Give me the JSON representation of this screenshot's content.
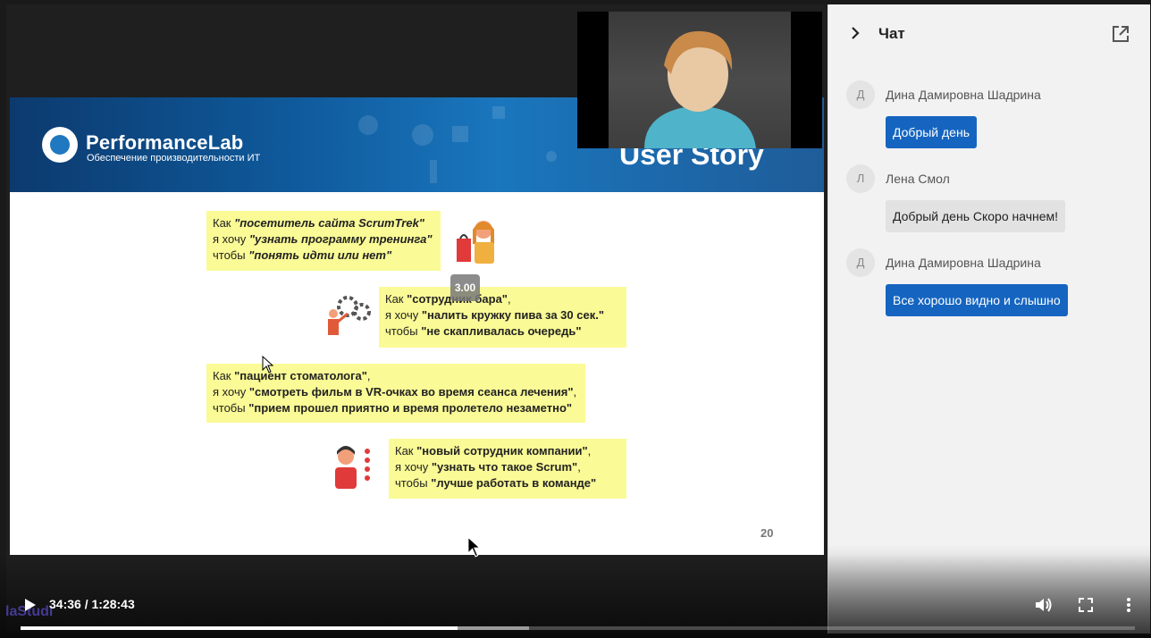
{
  "slide": {
    "brand_name": "PerformanceLab",
    "brand_tagline": "Обеспечение производительности ИТ",
    "title": "User Story",
    "page_number": "20",
    "stories": [
      {
        "line1_prefix": "Как ",
        "line1_value": "\"посетитель сайта ScrumTrek\"",
        "line2_prefix": "я хочу ",
        "line2_value": "\"узнать программу тренинга\"",
        "line3_prefix": "чтобы ",
        "line3_value": "\"понять идти или нет\""
      },
      {
        "line1_prefix": "Как ",
        "line1_value": "\"сотрудник бара\"",
        "line1_suffix": ",",
        "line2_prefix": "я хочу ",
        "line2_value": "\"налить кружку пива за 30 сек.\"",
        "line3_prefix": "чтобы ",
        "line3_value": "\"не скапливалась очередь\""
      },
      {
        "line1_prefix": "Как ",
        "line1_value": "\"пациент стоматолога\"",
        "line1_suffix": ",",
        "line2_prefix": "я хочу ",
        "line2_value": "\"смотреть фильм в VR-очках во время сеанса лечения\"",
        "line2_suffix": ",",
        "line3_prefix": "чтобы ",
        "line3_value": "\"прием прошел приятно и время пролетело незаметно\""
      },
      {
        "line1_prefix": "Как ",
        "line1_value": "\"новый сотрудник компании\"",
        "line1_suffix": ",",
        "line2_prefix": "я хочу ",
        "line2_value": "\"узнать что такое Scrum\"",
        "line2_suffix": ",",
        "line3_prefix": "чтобы ",
        "line3_value": "\"лучше работать в команде\""
      }
    ]
  },
  "player": {
    "speed_tooltip": "3.00",
    "time": "34:36 / 1:28:43",
    "progress_played": 0.392,
    "progress_buffered": 0.456,
    "watermark": "laStudi"
  },
  "chat": {
    "title": "Чат",
    "messages": [
      {
        "initial": "Д",
        "author": "Дина Дамировна Шадрина",
        "text": "Добрый день",
        "style": "blue"
      },
      {
        "initial": "Л",
        "author": "Лена Смол",
        "text": "Добрый день Скоро начнем!",
        "style": "grey"
      },
      {
        "initial": "Д",
        "author": "Дина Дамировна Шадрина",
        "text": "Все хорошо видно и слышно",
        "style": "blue"
      }
    ]
  },
  "colors": {
    "accent_blue": "#1565c0",
    "sticky_yellow": "#fafa96",
    "slide_header_blue": "#0f5a9c"
  }
}
